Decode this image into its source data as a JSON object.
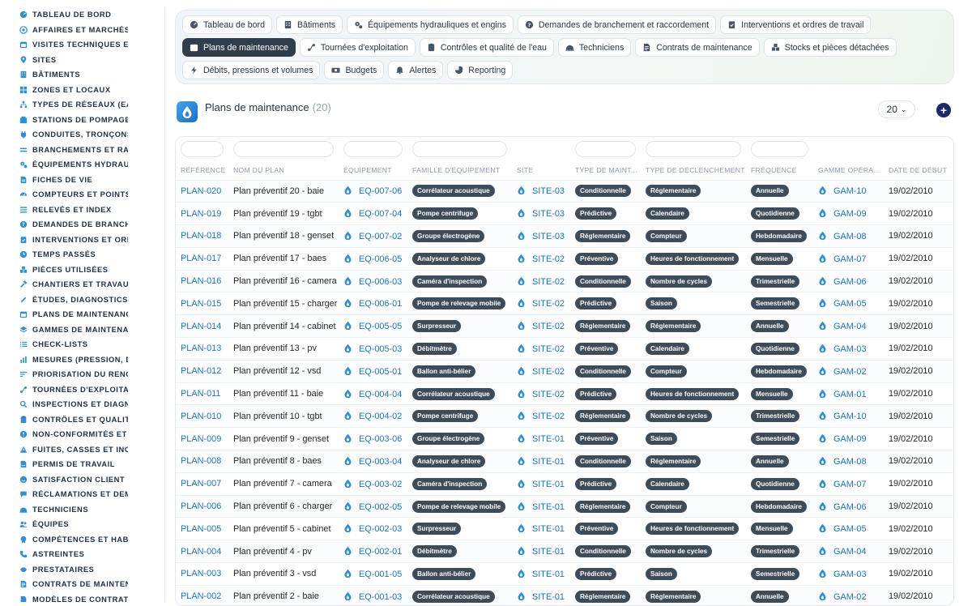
{
  "sidebar": {
    "items": [
      {
        "label": "TABLEAU DE BORD",
        "icon": "dashboard-icon"
      },
      {
        "label": "AFFAIRES ET MARCHÉS",
        "icon": "target-icon"
      },
      {
        "label": "VISITES TECHNIQUES ET",
        "icon": "calendar-icon"
      },
      {
        "label": "SITES",
        "icon": "map-pin-icon"
      },
      {
        "label": "BÂTIMENTS",
        "icon": "building-icon"
      },
      {
        "label": "ZONES ET LOCAUX",
        "icon": "grid-icon"
      },
      {
        "label": "TYPES DE RÉSEAUX (EAU",
        "icon": "sitemap-icon"
      },
      {
        "label": "STATIONS DE POMPAGE I",
        "icon": "station-icon"
      },
      {
        "label": "CONDUITES, TRONÇONS",
        "icon": "plug-icon"
      },
      {
        "label": "BRANCHEMENTS ET RAC",
        "icon": "branch-icon"
      },
      {
        "label": "ÉQUIPEMENTS HYDRAUL",
        "icon": "gears-icon"
      },
      {
        "label": "FICHES DE VIE",
        "icon": "document-icon"
      },
      {
        "label": "COMPTEURS ET POINTS I",
        "icon": "gauge-icon"
      },
      {
        "label": "RELEVÉS ET INDEX",
        "icon": "list-icon"
      },
      {
        "label": "DEMANDES DE BRANCHE",
        "icon": "question-icon"
      },
      {
        "label": "INTERVENTIONS ET ORDI",
        "icon": "clipboard-check-icon"
      },
      {
        "label": "TEMPS PASSÉS",
        "icon": "clock-icon"
      },
      {
        "label": "PIÈCES UTILISÉES",
        "icon": "boxes-icon"
      },
      {
        "label": "CHANTIERS ET TRAVAUX",
        "icon": "hammer-icon"
      },
      {
        "label": "ÉTUDES, DIAGNOSTICS E",
        "icon": "pen-icon"
      },
      {
        "label": "PLANS DE MAINTENANCE",
        "icon": "calendar-icon"
      },
      {
        "label": "GAMMES DE MAINTENAN",
        "icon": "layers-icon"
      },
      {
        "label": "CHECK-LISTS",
        "icon": "checklist-icon"
      },
      {
        "label": "MESURES (PRESSION, DÉ",
        "icon": "chart-icon"
      },
      {
        "label": "PRIORISATION DU RENOU",
        "icon": "sort-icon"
      },
      {
        "label": "TOURNÉES D'EXPLOITATI",
        "icon": "route-icon"
      },
      {
        "label": "INSPECTIONS ET DIAGNC",
        "icon": "search-icon"
      },
      {
        "label": "CONTRÔLES ET QUALITÉ",
        "icon": "clipboard-icon"
      },
      {
        "label": "NON-CONFORMITÉS ET A",
        "icon": "alert-circle-icon"
      },
      {
        "label": "FUITES, CASSES ET INCI",
        "icon": "warning-icon"
      },
      {
        "label": "PERMIS DE TRAVAIL",
        "icon": "file-signature-icon"
      },
      {
        "label": "SATISFACTION CLIENT",
        "icon": "smile-icon"
      },
      {
        "label": "RÉCLAMATIONS ET DEMA",
        "icon": "comment-icon"
      },
      {
        "label": "TECHNICIENS",
        "icon": "hard-hat-icon"
      },
      {
        "label": "ÉQUIPES",
        "icon": "users-icon"
      },
      {
        "label": "COMPÉTENCES ET HABIL",
        "icon": "certificate-icon"
      },
      {
        "label": "ASTREINTES",
        "icon": "phone-icon"
      },
      {
        "label": "PRESTATAIRES",
        "icon": "handshake-icon"
      },
      {
        "label": "CONTRATS DE MAINTENA",
        "icon": "contract-icon"
      },
      {
        "label": "MODÈLES DE CONTRATS",
        "icon": "file-icon"
      }
    ]
  },
  "topnav": {
    "rows": [
      [
        {
          "label": "Tableau de bord",
          "icon": "dashboard-icon",
          "active": false
        },
        {
          "label": "Bâtiments",
          "icon": "building-icon",
          "active": false
        },
        {
          "label": "Équipements hydrauliques et engins",
          "icon": "gears-icon",
          "active": false
        },
        {
          "label": "Demandes de branchement et raccordement",
          "icon": "question-icon",
          "active": false
        },
        {
          "label": "Interventions et ordres de travail",
          "icon": "clipboard-check-icon",
          "active": false
        }
      ],
      [
        {
          "label": "Plans de maintenance",
          "icon": "calendar-icon",
          "active": true
        },
        {
          "label": "Tournées d'exploitation",
          "icon": "route-icon",
          "active": false
        },
        {
          "label": "Contrôles et qualité de l'eau",
          "icon": "clipboard-icon",
          "active": false
        },
        {
          "label": "Techniciens",
          "icon": "hard-hat-icon",
          "active": false
        },
        {
          "label": "Contrats de maintenance",
          "icon": "contract-icon",
          "active": false
        },
        {
          "label": "Stocks et pièces détachées",
          "icon": "boxes-icon",
          "active": false
        }
      ],
      [
        {
          "label": "Débits, pressions et volumes",
          "icon": "bolt-icon",
          "active": false
        },
        {
          "label": "Budgets",
          "icon": "money-icon",
          "active": false
        },
        {
          "label": "Alertes",
          "icon": "bell-icon",
          "active": false
        },
        {
          "label": "Reporting",
          "icon": "pie-chart-icon",
          "active": false
        }
      ]
    ]
  },
  "header": {
    "title": "Plans de maintenance",
    "count": "(20)",
    "page_size": "20",
    "logo_icon": "water-drop-icon",
    "add_icon": "plus-icon"
  },
  "table": {
    "columns": [
      "RÉFÉRENCE",
      "NOM DU PLAN",
      "ÉQUIPEMENT",
      "FAMILLE D'ÉQUIPEMENT",
      "SITE",
      "TYPE DE MAINT...",
      "TYPE DE DÉCLENCHEMENT",
      "FRÉQUENCE",
      "GAMME OPÉRA...",
      "DATE DE DÉBUT"
    ],
    "filterable": [
      true,
      true,
      true,
      true,
      false,
      true,
      true,
      true,
      false,
      false
    ],
    "rows": [
      {
        "ref": "PLAN-020",
        "name": "Plan préventif 20 - baie",
        "equip": "EQ-007-06",
        "family": "Corrélateur acoustique",
        "site": "SITE-03",
        "type": "Conditionnelle",
        "trigger": "Réglementaire",
        "freq": "Annuelle",
        "gamme": "GAM-10",
        "date": "19/02/2010"
      },
      {
        "ref": "PLAN-019",
        "name": "Plan préventif 19 - tgbt",
        "equip": "EQ-007-04",
        "family": "Pompe centrifuge",
        "site": "SITE-03",
        "type": "Prédictive",
        "trigger": "Calendaire",
        "freq": "Quotidienne",
        "gamme": "GAM-09",
        "date": "19/02/2010"
      },
      {
        "ref": "PLAN-018",
        "name": "Plan préventif 18 - genset",
        "equip": "EQ-007-02",
        "family": "Groupe électrogène",
        "site": "SITE-03",
        "type": "Réglementaire",
        "trigger": "Compteur",
        "freq": "Hebdomadaire",
        "gamme": "GAM-08",
        "date": "19/02/2010"
      },
      {
        "ref": "PLAN-017",
        "name": "Plan préventif 17 - baes",
        "equip": "EQ-006-05",
        "family": "Analyseur de chlore",
        "site": "SITE-02",
        "type": "Préventive",
        "trigger": "Heures de fonctionnement",
        "freq": "Mensuelle",
        "gamme": "GAM-07",
        "date": "19/02/2010"
      },
      {
        "ref": "PLAN-016",
        "name": "Plan préventif 16 - camera",
        "equip": "EQ-006-03",
        "family": "Caméra d'inspection",
        "site": "SITE-02",
        "type": "Conditionnelle",
        "trigger": "Nombre de cycles",
        "freq": "Trimestrielle",
        "gamme": "GAM-06",
        "date": "19/02/2010"
      },
      {
        "ref": "PLAN-015",
        "name": "Plan préventif 15 - charger",
        "equip": "EQ-006-01",
        "family": "Pompe de relevage mobile",
        "site": "SITE-02",
        "type": "Prédictive",
        "trigger": "Saison",
        "freq": "Semestrielle",
        "gamme": "GAM-05",
        "date": "19/02/2010"
      },
      {
        "ref": "PLAN-014",
        "name": "Plan préventif 14 - cabinet",
        "equip": "EQ-005-05",
        "family": "Surpresseur",
        "site": "SITE-02",
        "type": "Réglementaire",
        "trigger": "Réglementaire",
        "freq": "Annuelle",
        "gamme": "GAM-04",
        "date": "19/02/2010"
      },
      {
        "ref": "PLAN-013",
        "name": "Plan préventif 13 - pv",
        "equip": "EQ-005-03",
        "family": "Débitmètre",
        "site": "SITE-02",
        "type": "Préventive",
        "trigger": "Calendaire",
        "freq": "Quotidienne",
        "gamme": "GAM-03",
        "date": "19/02/2010"
      },
      {
        "ref": "PLAN-012",
        "name": "Plan préventif 12 - vsd",
        "equip": "EQ-005-01",
        "family": "Ballon anti-bélier",
        "site": "SITE-02",
        "type": "Conditionnelle",
        "trigger": "Compteur",
        "freq": "Hebdomadaire",
        "gamme": "GAM-02",
        "date": "19/02/2010"
      },
      {
        "ref": "PLAN-011",
        "name": "Plan préventif 11 - baie",
        "equip": "EQ-004-04",
        "family": "Corrélateur acoustique",
        "site": "SITE-02",
        "type": "Prédictive",
        "trigger": "Heures de fonctionnement",
        "freq": "Mensuelle",
        "gamme": "GAM-01",
        "date": "19/02/2010"
      },
      {
        "ref": "PLAN-010",
        "name": "Plan préventif 10 - tgbt",
        "equip": "EQ-004-02",
        "family": "Pompe centrifuge",
        "site": "SITE-02",
        "type": "Réglementaire",
        "trigger": "Nombre de cycles",
        "freq": "Trimestrielle",
        "gamme": "GAM-10",
        "date": "19/02/2010"
      },
      {
        "ref": "PLAN-009",
        "name": "Plan préventif 9 - genset",
        "equip": "EQ-003-06",
        "family": "Groupe électrogène",
        "site": "SITE-01",
        "type": "Préventive",
        "trigger": "Saison",
        "freq": "Semestrielle",
        "gamme": "GAM-09",
        "date": "19/02/2010"
      },
      {
        "ref": "PLAN-008",
        "name": "Plan préventif 8 - baes",
        "equip": "EQ-003-04",
        "family": "Analyseur de chlore",
        "site": "SITE-01",
        "type": "Conditionnelle",
        "trigger": "Réglementaire",
        "freq": "Annuelle",
        "gamme": "GAM-08",
        "date": "19/02/2010"
      },
      {
        "ref": "PLAN-007",
        "name": "Plan préventif 7 - camera",
        "equip": "EQ-003-02",
        "family": "Caméra d'inspection",
        "site": "SITE-01",
        "type": "Prédictive",
        "trigger": "Calendaire",
        "freq": "Quotidienne",
        "gamme": "GAM-07",
        "date": "19/02/2010"
      },
      {
        "ref": "PLAN-006",
        "name": "Plan préventif 6 - charger",
        "equip": "EQ-002-05",
        "family": "Pompe de relevage mobile",
        "site": "SITE-01",
        "type": "Réglementaire",
        "trigger": "Compteur",
        "freq": "Hebdomadaire",
        "gamme": "GAM-06",
        "date": "19/02/2010"
      },
      {
        "ref": "PLAN-005",
        "name": "Plan préventif 5 - cabinet",
        "equip": "EQ-002-03",
        "family": "Surpresseur",
        "site": "SITE-01",
        "type": "Préventive",
        "trigger": "Heures de fonctionnement",
        "freq": "Mensuelle",
        "gamme": "GAM-05",
        "date": "19/02/2010"
      },
      {
        "ref": "PLAN-004",
        "name": "Plan préventif 4 - pv",
        "equip": "EQ-002-01",
        "family": "Débitmètre",
        "site": "SITE-01",
        "type": "Conditionnelle",
        "trigger": "Nombre de cycles",
        "freq": "Trimestrielle",
        "gamme": "GAM-04",
        "date": "19/02/2010"
      },
      {
        "ref": "PLAN-003",
        "name": "Plan préventif 3 - vsd",
        "equip": "EQ-001-05",
        "family": "Ballon anti-bélier",
        "site": "SITE-01",
        "type": "Prédictive",
        "trigger": "Saison",
        "freq": "Semestrielle",
        "gamme": "GAM-03",
        "date": "19/02/2010"
      },
      {
        "ref": "PLAN-002",
        "name": "Plan préventif 2 - baie",
        "equip": "EQ-001-03",
        "family": "Corrélateur acoustique",
        "site": "SITE-01",
        "type": "Réglementaire",
        "trigger": "Réglementaire",
        "freq": "Annuelle",
        "gamme": "GAM-02",
        "date": "19/02/2010"
      }
    ]
  },
  "colors": {
    "accent": "#1a73c8",
    "active_pill": "#2f3d4c",
    "badge": "#3e4b58",
    "add_button": "#1b2a6b"
  }
}
